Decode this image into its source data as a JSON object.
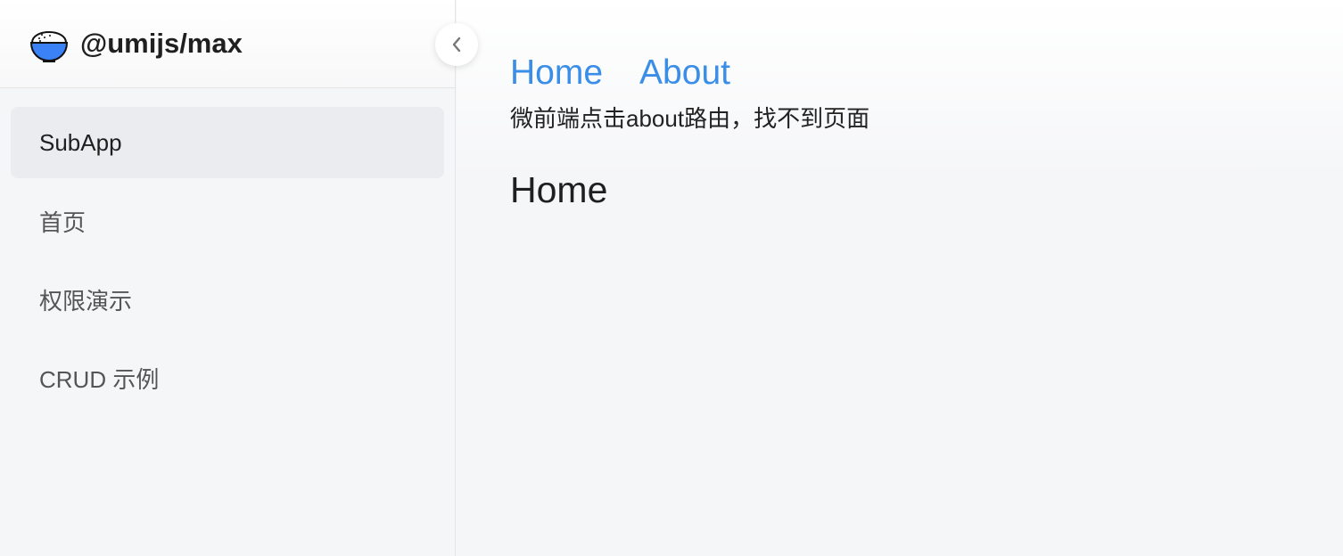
{
  "app": {
    "title": "@umijs/max"
  },
  "icons": {
    "logo": "rice-bowl-icon",
    "collapse": "chevron-left-icon"
  },
  "colors": {
    "link": "#3b8ee8",
    "active_bg": "#ebecef",
    "logo_blue": "#3b82f6"
  },
  "sidebar": {
    "items": [
      {
        "label": "SubApp",
        "active": true
      },
      {
        "label": "首页"
      },
      {
        "label": "权限演示"
      },
      {
        "label": "CRUD 示例"
      }
    ]
  },
  "main": {
    "nav": [
      {
        "label": "Home"
      },
      {
        "label": "About"
      }
    ],
    "note": "微前端点击about路由，找不到页面",
    "heading": "Home"
  }
}
